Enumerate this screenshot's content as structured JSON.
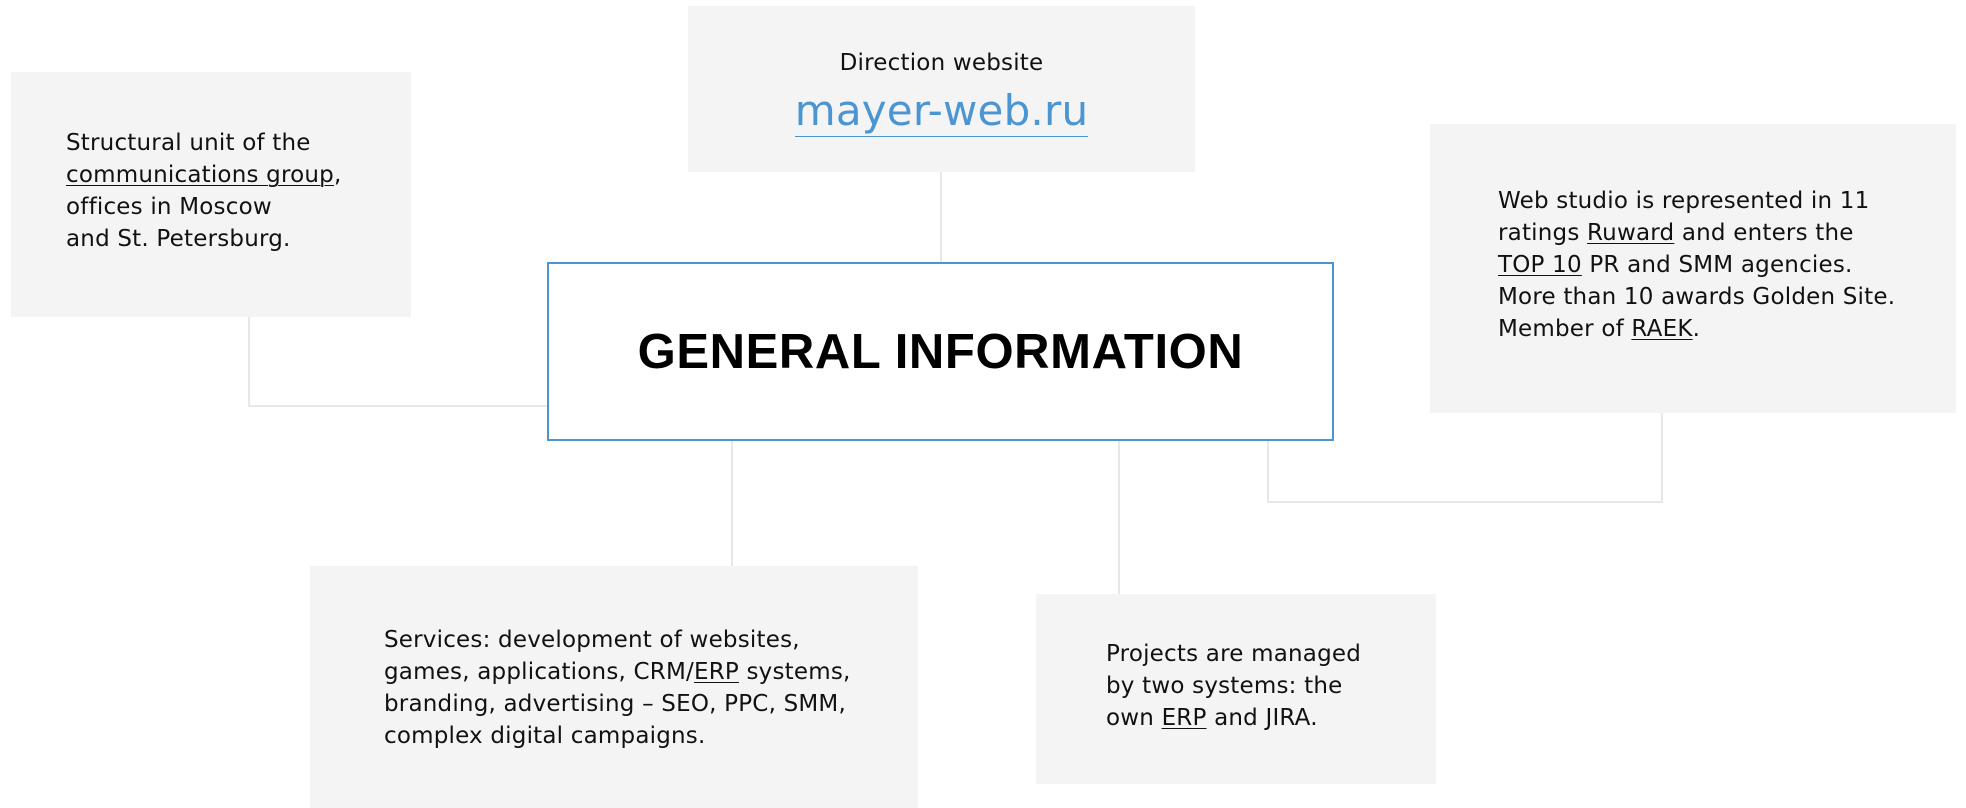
{
  "center": {
    "title": "GENERAL INFORMATION"
  },
  "website": {
    "label": "Direction website",
    "link": "mayer-web.ru"
  },
  "structure": {
    "line1": "Structural unit of the",
    "link": "communications group",
    "after_link": ",",
    "line3": "offices in Moscow",
    "line4": "and St. Petersburg."
  },
  "ratings": {
    "line1": "Web studio is represented in 11",
    "line2_pre": "ratings ",
    "link_ruward": "Ruward",
    "line2_post": " and enters the",
    "link_top10": "TOP 10",
    "line3_post": " PR and SMM agencies.",
    "line4": "More than 10 awards Golden Site.",
    "line5_pre": "Member of ",
    "link_raek": "RAEK",
    "line5_post": "."
  },
  "services": {
    "line1": "Services: development of websites,",
    "line2_pre": "games, applications, CRM/",
    "link_erp": "ERP",
    "line2_post": " systems,",
    "line3": "branding, advertising – SEO, PPC, SMM,",
    "line4": "complex digital campaigns."
  },
  "projects": {
    "line1": "Projects are managed",
    "line2": "by two systems: the",
    "line3_pre": "own ",
    "link_erp": "ERP",
    "line3_post": " and JIRA."
  },
  "colors": {
    "accent": "#4a95d2",
    "card_background": "#f4f4f4",
    "connector": "#e1e1e1"
  }
}
